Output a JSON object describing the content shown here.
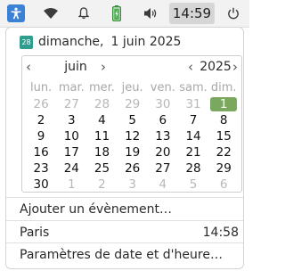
{
  "topbar": {
    "clock": "14:59",
    "icons": [
      "accessibility-icon",
      "wifi-icon",
      "bell-icon",
      "battery-icon",
      "volume-icon",
      "power-icon"
    ],
    "accent": "#3b82d6"
  },
  "popover": {
    "date_day": "dimanche,",
    "date_full": "1 juin 2025",
    "calendar": {
      "month": "juin",
      "year": "2025",
      "weekdays": [
        "lun.",
        "mar.",
        "mer.",
        "jeu.",
        "ven.",
        "sam.",
        "dim."
      ],
      "weeks": [
        [
          "26",
          "27",
          "28",
          "29",
          "30",
          "31",
          "1"
        ],
        [
          "2",
          "3",
          "4",
          "5",
          "6",
          "7",
          "8"
        ],
        [
          "9",
          "10",
          "11",
          "12",
          "13",
          "14",
          "15"
        ],
        [
          "16",
          "17",
          "18",
          "19",
          "20",
          "21",
          "22"
        ],
        [
          "23",
          "24",
          "25",
          "26",
          "27",
          "28",
          "29"
        ],
        [
          "30",
          "1",
          "2",
          "3",
          "4",
          "5",
          "6"
        ]
      ],
      "today_color": "#7aa85e"
    },
    "add_event": "Ajouter un évènement…",
    "world_clock": {
      "city": "Paris",
      "time": "14:58"
    },
    "settings": "Paramètres de date et d'heure…"
  }
}
